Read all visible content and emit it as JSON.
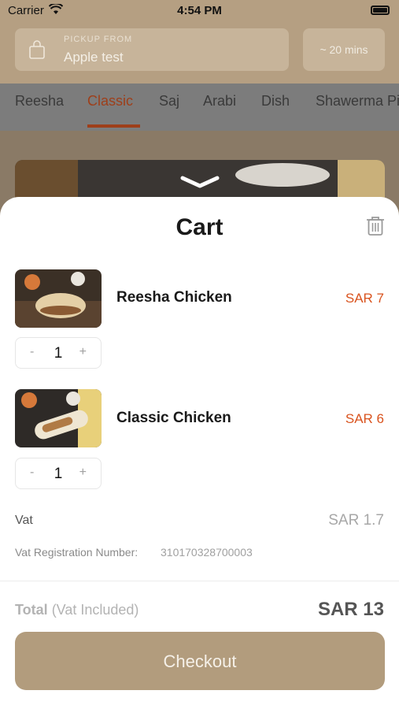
{
  "status_bar": {
    "carrier": "Carrier",
    "time": "4:54 PM"
  },
  "header": {
    "pickup_label": "PICKUP FROM",
    "pickup_value": "Apple test",
    "eta": "~ 20 mins"
  },
  "tabs": [
    {
      "label": "Reesha"
    },
    {
      "label": "Classic",
      "active": true
    },
    {
      "label": "Saj"
    },
    {
      "label": "Arabi"
    },
    {
      "label": "Dish"
    },
    {
      "label": "Shawerma Pi"
    }
  ],
  "cart": {
    "title": "Cart",
    "items": [
      {
        "name": "Reesha Chicken",
        "price": "SAR 7",
        "quantity": "1",
        "minus": "-",
        "plus": "+"
      },
      {
        "name": "Classic Chicken",
        "price": "SAR 6",
        "quantity": "1",
        "minus": "-",
        "plus": "+"
      }
    ],
    "vat_label": "Vat",
    "vat_value": "SAR 1.7",
    "vat_reg_label": "Vat Registration Number:",
    "vat_reg_value": "310170328700003",
    "total_label": "Total",
    "total_note": "(Vat Included)",
    "total_value": "SAR 13",
    "checkout_label": "Checkout"
  },
  "colors": {
    "accent": "#d9531e",
    "brand_brown": "#b29c7d",
    "tab_active": "#9e3f1a"
  },
  "icons": [
    "wifi-icon",
    "battery-icon",
    "shopping-bag-icon",
    "chevron-down-icon",
    "trash-icon"
  ]
}
